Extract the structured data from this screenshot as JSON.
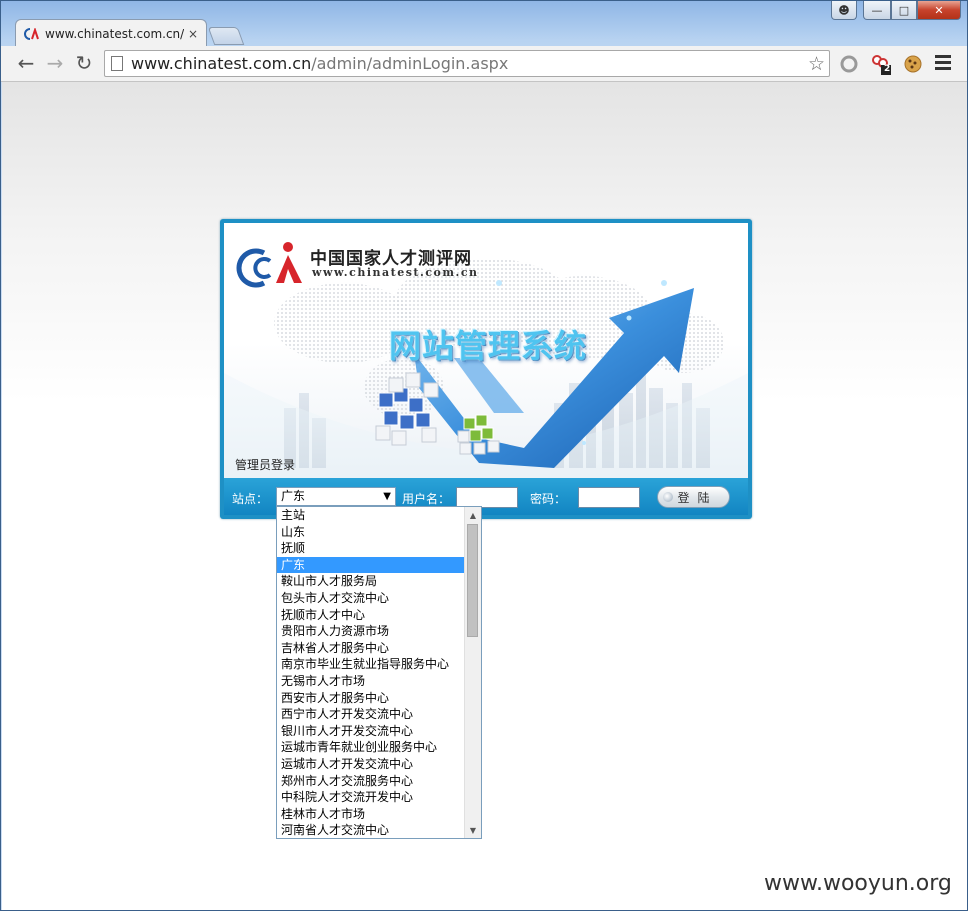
{
  "browser": {
    "tab_title": "www.chinatest.com.cn/a",
    "tab_close": "×",
    "url_host": "www.chinatest.com.cn",
    "url_path": "/admin/adminLogin.aspx",
    "extension_badge": "2"
  },
  "banner": {
    "logo_cn": "中国国家人才测评网",
    "logo_en": "www.chinatest.com.cn",
    "system_title": "网站管理系统",
    "admin_label": "管理员登录"
  },
  "form": {
    "site_label": "站点：",
    "site_selected": "广东",
    "username_label": "用户名：",
    "password_label": "密码：",
    "login_label": "登陆"
  },
  "dropdown": {
    "selected_index": 3,
    "options": [
      "主站",
      "山东",
      "抚顺",
      "广东",
      "鞍山市人才服务局",
      "包头市人才交流中心",
      "抚顺市人才中心",
      "贵阳市人力资源市场",
      "吉林省人才服务中心",
      "南京市毕业生就业指导服务中心",
      "无锡市人才市场",
      "西安市人才服务中心",
      "西宁市人才开发交流中心",
      "银川市人才开发交流中心",
      "运城市青年就业创业服务中心",
      "运城市人才开发交流中心",
      "郑州市人才交流服务中心",
      "中科院人才交流开发中心",
      "桂林市人才市场",
      "河南省人才交流中心"
    ]
  },
  "watermark": "www.wooyun.org",
  "colors": {
    "panel_blue": "#1e90c5",
    "selection": "#3399ff",
    "logo_red": "#d7252b",
    "logo_blue": "#1f5aa8"
  }
}
